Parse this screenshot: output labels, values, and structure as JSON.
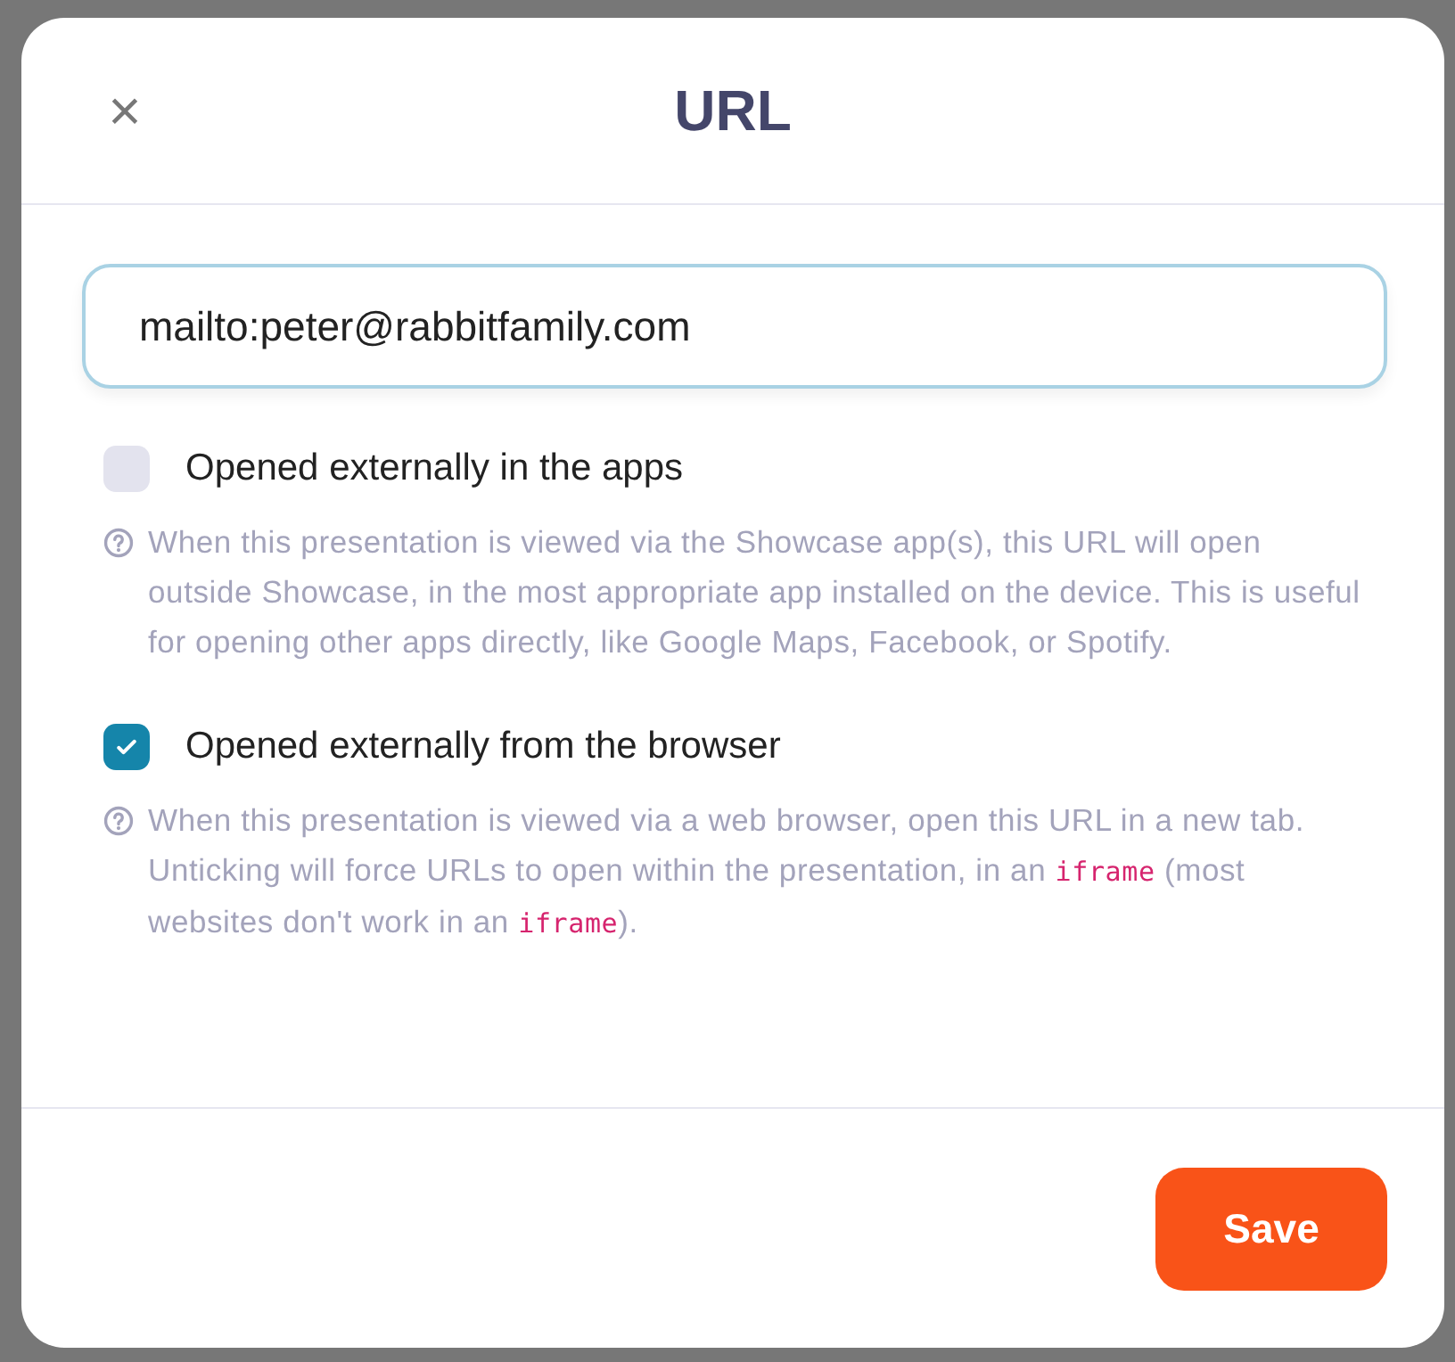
{
  "dialog": {
    "title": "URL",
    "close_icon": "×"
  },
  "url_field": {
    "value": "mailto:peter@rabbitfamily.com"
  },
  "options": [
    {
      "label": "Opened externally in the apps",
      "checked": false,
      "help": [
        {
          "kind": "text",
          "text": "When this presentation is viewed via the Showcase app(s), this URL will open outside Showcase, in the most appropriate app installed on the device. This is useful for opening other apps directly, like Google Maps, Facebook, or Spotify."
        }
      ]
    },
    {
      "label": "Opened externally from the browser",
      "checked": true,
      "help": [
        {
          "kind": "text",
          "text": "When this presentation is viewed via a web browser, open this URL in a new tab. Unticking will force URLs to open within the presentation, in an "
        },
        {
          "kind": "code",
          "text": "iframe"
        },
        {
          "kind": "text",
          "text": " (most websites don't work in an "
        },
        {
          "kind": "code",
          "text": "iframe"
        },
        {
          "kind": "text",
          "text": ")."
        }
      ]
    }
  ],
  "buttons": [
    {
      "label": "Save"
    }
  ]
}
